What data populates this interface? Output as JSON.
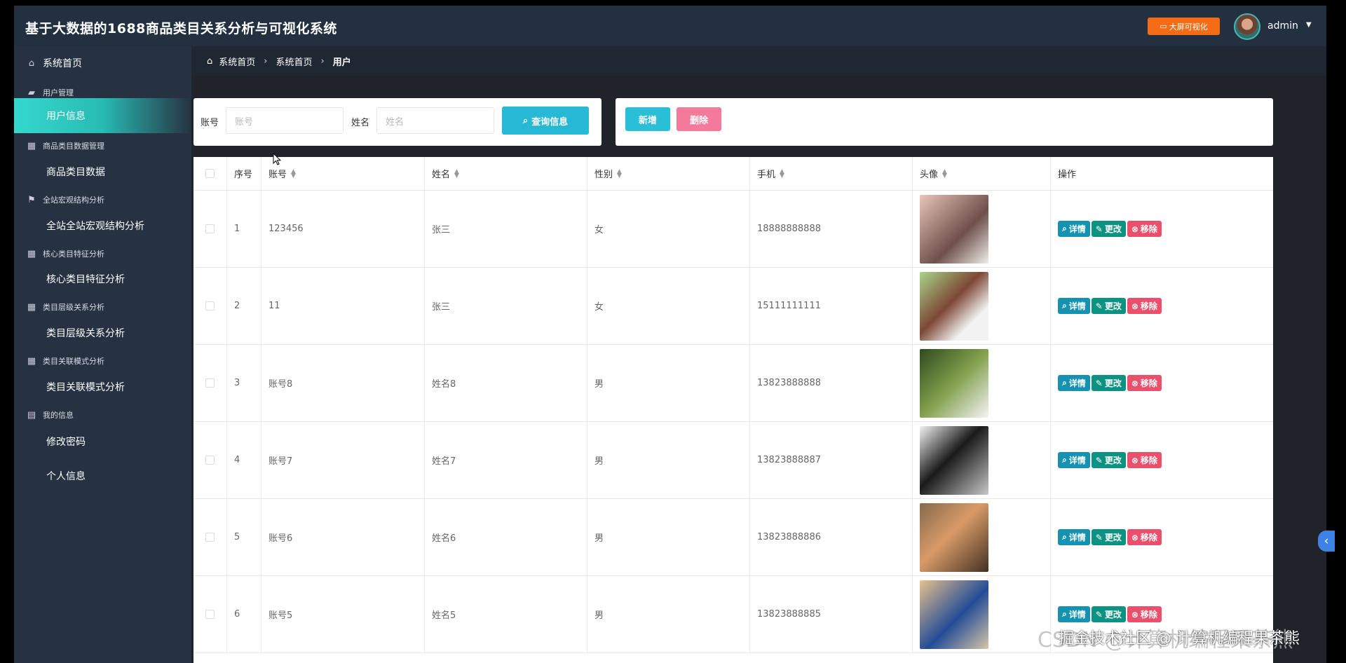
{
  "app": {
    "title": "基于大数据的1688商品类目关系分析与可视化系统",
    "screen_button": "大屏可视化",
    "user": "admin"
  },
  "sidebar": {
    "home": "系统首页",
    "sections": [
      {
        "label": "用户管理",
        "items": [
          "用户信息"
        ]
      },
      {
        "label": "商品类目数据管理",
        "items": [
          "商品类目数据"
        ]
      },
      {
        "label": "全站宏观结构分析",
        "items": [
          "全站全站宏观结构分析"
        ]
      },
      {
        "label": "核心类目特征分析",
        "items": [
          "核心类目特征分析"
        ]
      },
      {
        "label": "类目层级关系分析",
        "items": [
          "类目层级关系分析"
        ]
      },
      {
        "label": "类目关联模式分析",
        "items": [
          "类目关联模式分析"
        ]
      },
      {
        "label": "我的信息",
        "items": [
          "修改密码",
          "个人信息"
        ]
      }
    ]
  },
  "breadcrumb": [
    "系统首页",
    "系统首页",
    "用户"
  ],
  "search": {
    "account_label": "账号",
    "account_placeholder": "账号",
    "name_label": "姓名",
    "name_placeholder": "姓名",
    "query_button": "查询信息"
  },
  "actions": {
    "add": "新增",
    "delete": "删除"
  },
  "table": {
    "headers": [
      "序号",
      "账号",
      "姓名",
      "性别",
      "手机",
      "头像",
      "操作"
    ],
    "rows": [
      {
        "no": "1",
        "account": "123456",
        "name": "张三",
        "gender": "女",
        "phone": "18888888888"
      },
      {
        "no": "2",
        "account": "11",
        "name": "张三",
        "gender": "女",
        "phone": "15111111111"
      },
      {
        "no": "3",
        "account": "账号8",
        "name": "姓名8",
        "gender": "男",
        "phone": "13823888888"
      },
      {
        "no": "4",
        "account": "账号7",
        "name": "姓名7",
        "gender": "男",
        "phone": "13823888887"
      },
      {
        "no": "5",
        "account": "账号6",
        "name": "姓名6",
        "gender": "男",
        "phone": "13823888886"
      },
      {
        "no": "6",
        "account": "账号5",
        "name": "姓名5",
        "gender": "男",
        "phone": "13823888885"
      }
    ],
    "ops": [
      "详情",
      "更改",
      "移除"
    ]
  },
  "watermark": "掘金技术社区 @ 计算机编程果茶熊",
  "watermark_back": "CSDN @计算机编程果茶熊"
}
